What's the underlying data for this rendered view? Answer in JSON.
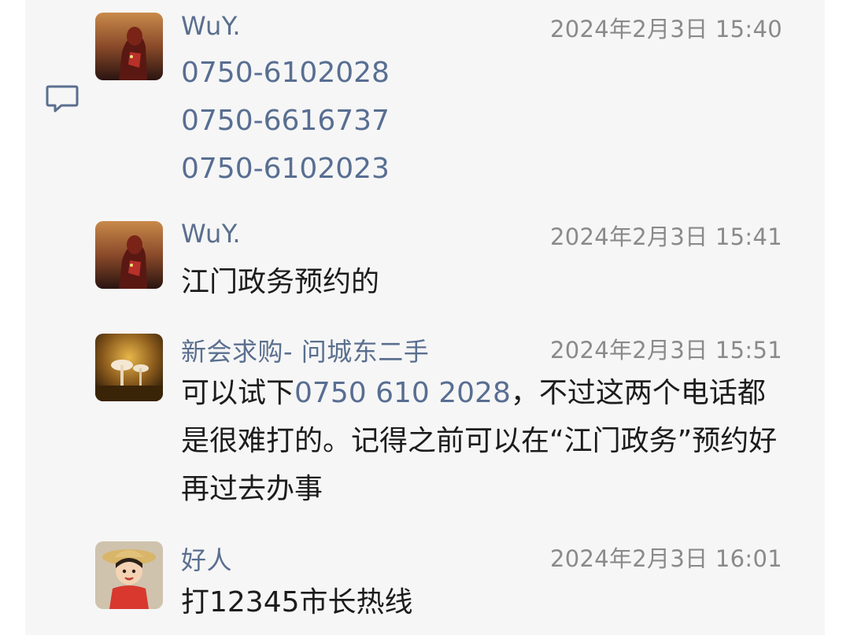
{
  "messages": [
    {
      "name": "WuY.",
      "time": "2024年2月3日 15:40",
      "phones": [
        "0750-6102028",
        "0750-6616737",
        "0750-6102023"
      ]
    },
    {
      "name": "WuY.",
      "time": "2024年2月3日 15:41",
      "text": "江门政务预约的"
    },
    {
      "name": "新会求购- 问城东二手",
      "time": "2024年2月3日 15:51",
      "text_before": "可以试下",
      "link": "0750 610 2028",
      "text_after": "，不过这两个电话都是很难打的。记得之前可以在“江门政务”预约好再过去办事"
    },
    {
      "name": "好人",
      "time": "2024年2月3日 16:01",
      "text": "打12345市长热线"
    }
  ],
  "icons": {
    "comment": "comment-icon",
    "avatar_1": "avatar-red-hero",
    "avatar_3": "avatar-mushrooms",
    "avatar_4": "avatar-cartoon-boy"
  },
  "colors": {
    "name": "#5a6f8f",
    "link": "#586e92",
    "time": "#8a8a8a",
    "text": "#1c1c1c",
    "background": "#f6f6f6"
  }
}
